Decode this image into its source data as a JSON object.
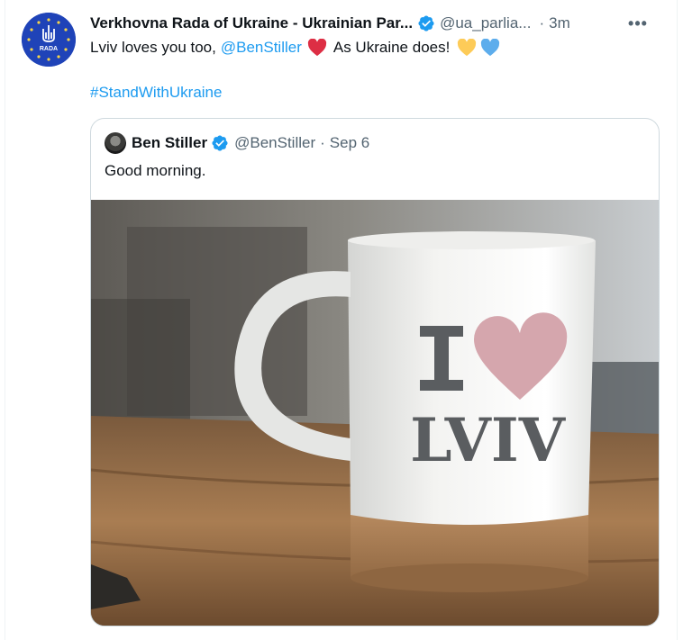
{
  "tweet": {
    "author": {
      "display_name": "Verkhovna Rada of Ukraine - Ukrainian Par...",
      "handle": "@ua_parlia...",
      "verified": true,
      "avatar_text": "RADA"
    },
    "timestamp": "3m",
    "more_icon": "more-horizontal-icon",
    "text": {
      "lead": "Lviv loves you too,",
      "mention": "@BenStiller",
      "middle": "As Ukraine does!"
    },
    "hashtag": "#StandWithUkraine",
    "emoji": [
      "red-heart",
      "yellow-heart",
      "blue-heart"
    ]
  },
  "quote": {
    "author": {
      "display_name": "Ben Stiller",
      "handle": "@BenStiller",
      "verified": true
    },
    "timestamp": "Sep 6",
    "text": "Good morning.",
    "media": {
      "description_icon": "photo-mug",
      "mug_text_top": "I",
      "mug_text_bottom": "LVIV"
    }
  },
  "colors": {
    "link": "#1d9bf0",
    "secondary": "#536471",
    "border": "#cfd9de",
    "rada_blue": "#1f43b8",
    "verified": "#1d9bf0"
  }
}
